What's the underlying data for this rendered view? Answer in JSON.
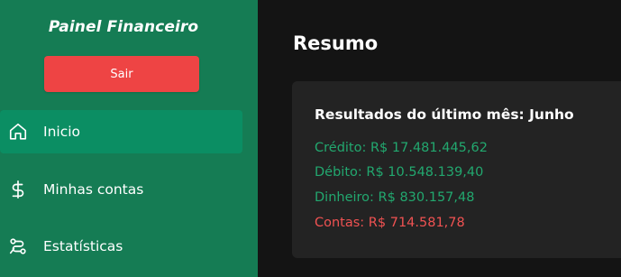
{
  "sidebar": {
    "brand": "Painel Financeiro",
    "logout_label": "Sair",
    "items": [
      {
        "label": "Inicio",
        "icon": "home-icon",
        "active": true
      },
      {
        "label": "Minhas contas",
        "icon": "dollar-icon",
        "active": false
      },
      {
        "label": "Estatísticas",
        "icon": "statistics-icon",
        "active": false
      }
    ]
  },
  "main": {
    "title": "Resumo",
    "card": {
      "title": "Resultados do último mês: Junho",
      "stats": [
        {
          "text": "Crédito: R$ 17.481.445,62",
          "color": "#22a86f"
        },
        {
          "text": "Débito: R$ 10.548.139,40",
          "color": "#22a86f"
        },
        {
          "text": "Dinheiro: R$ 830.157,48",
          "color": "#22a86f"
        },
        {
          "text": "Contas: R$ 714.581,78",
          "color": "#f05252"
        }
      ]
    }
  },
  "colors": {
    "sidebar_bg": "#157c54",
    "active_item_bg": "#0b8e63",
    "logout_bg": "#ee4444",
    "main_bg": "#141414",
    "card_bg": "#232323"
  }
}
